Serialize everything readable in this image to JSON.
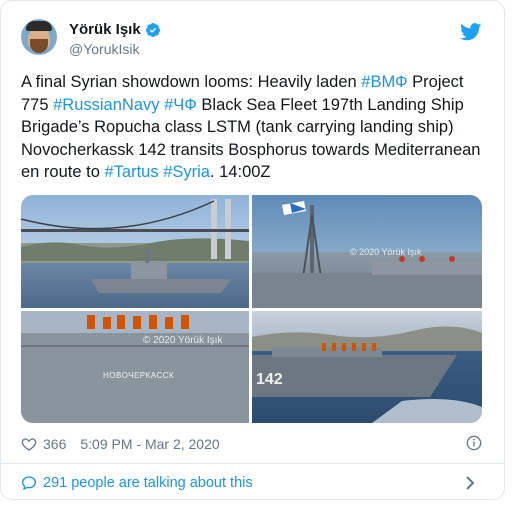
{
  "author": {
    "display_name": "Yörük Işık",
    "handle": "@YorukIsik"
  },
  "tweet": {
    "segments": [
      {
        "text": "A final Syrian showdown looms: Heavily laden ",
        "type": "text"
      },
      {
        "text": "#ВМФ",
        "type": "tag"
      },
      {
        "text": " Project 775 ",
        "type": "text"
      },
      {
        "text": "#RussianNavy",
        "type": "tag"
      },
      {
        "text": " ",
        "type": "text"
      },
      {
        "text": "#ЧФ",
        "type": "tag"
      },
      {
        "text": " Black Sea Fleet 197th Landing Ship Brigade’s Ropucha class LSTM (tank carrying landing ship) Novocherkassk 142 transits Bosphorus towards Mediterranean en route to ",
        "type": "text"
      },
      {
        "text": "#Tartus",
        "type": "tag"
      },
      {
        "text": " ",
        "type": "text"
      },
      {
        "text": "#Syria",
        "type": "tag"
      },
      {
        "text": ". 14:00Z",
        "type": "text"
      }
    ]
  },
  "media": {
    "watermarks": [
      "© 2020 Yörük Işık",
      "© 2020 Yörük Işık"
    ],
    "ship_name": "НОВОЧЕРКАССК",
    "hull_number": "142"
  },
  "stats": {
    "likes": "366",
    "timestamp": "5:09 PM - Mar 2, 2020"
  },
  "talking": {
    "label": "291 people are talking about this"
  },
  "colors": {
    "link": "#1b95e0",
    "muted": "#657786",
    "text": "#14171a",
    "border": "#e1e8ed"
  }
}
